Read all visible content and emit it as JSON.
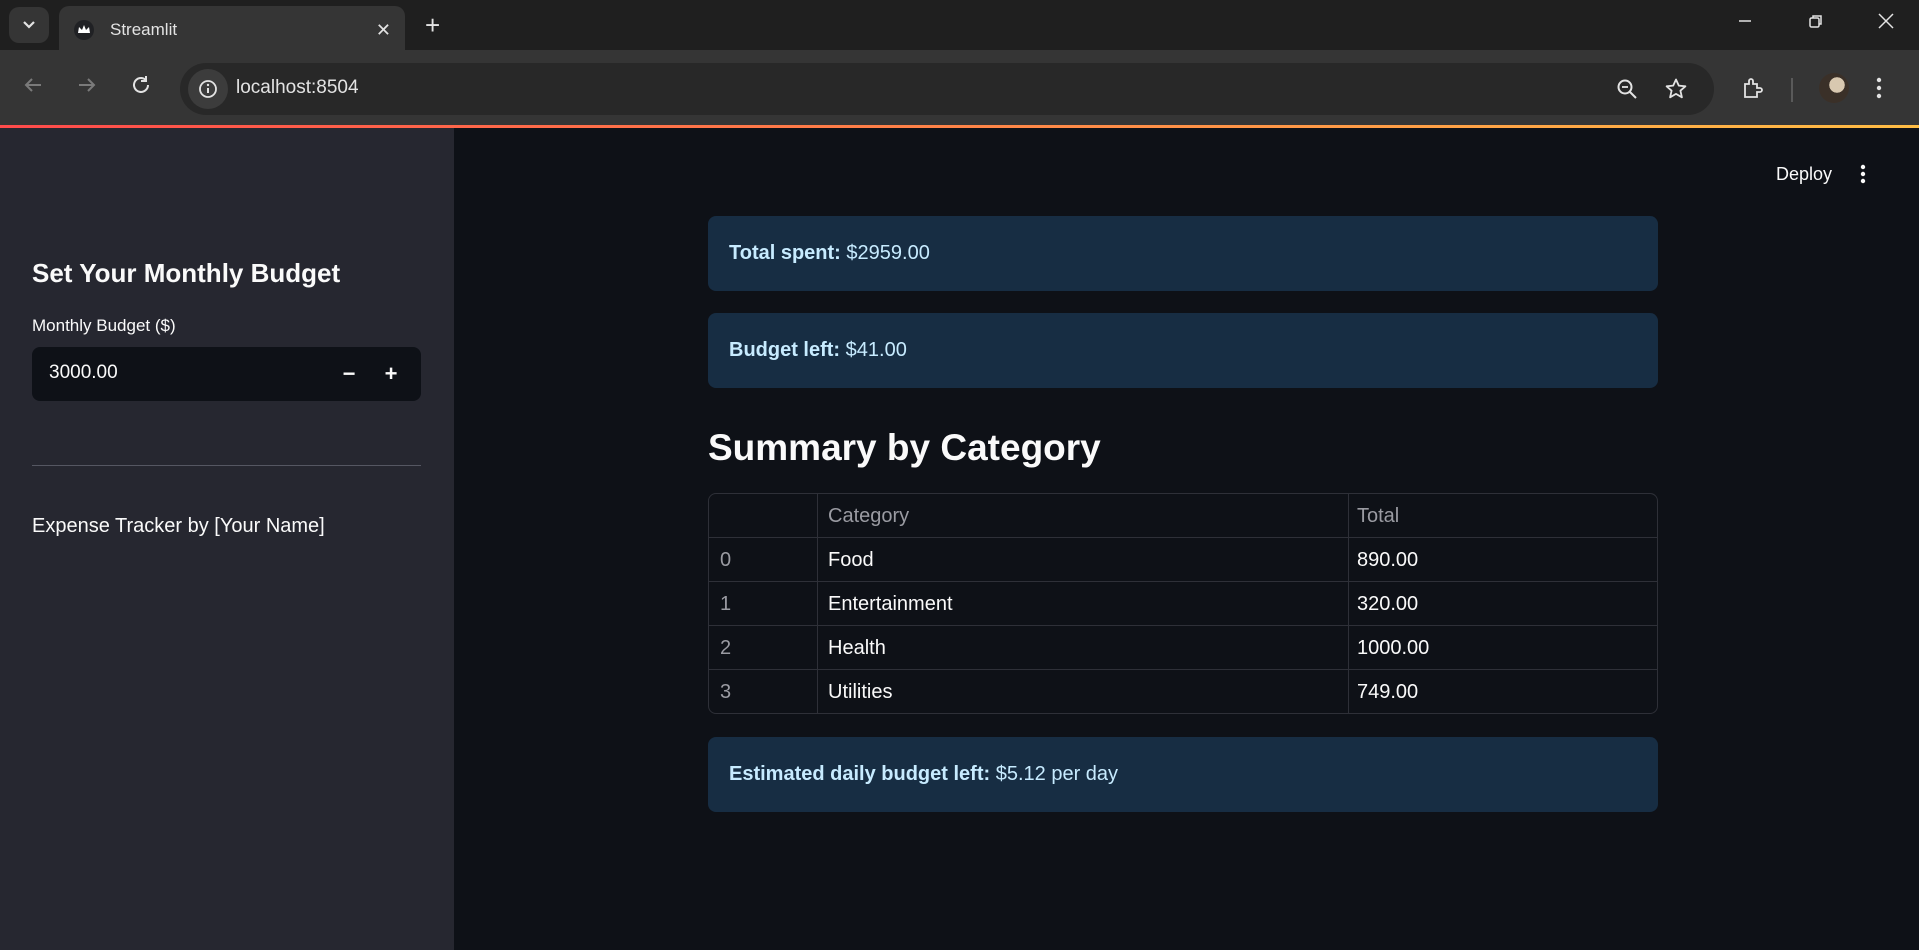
{
  "browser": {
    "tab_title": "Streamlit",
    "url": "localhost:8504"
  },
  "header": {
    "deploy_label": "Deploy"
  },
  "sidebar": {
    "title": "Set Your Monthly Budget",
    "budget_label": "Monthly Budget ($)",
    "budget_value": "3000.00",
    "decrement_label": "−",
    "increment_label": "+",
    "footer_text": "Expense Tracker by [Your Name]"
  },
  "main": {
    "total_spent": {
      "label": "Total spent:",
      "value": "$2959.00"
    },
    "budget_left": {
      "label": "Budget left:",
      "value": "$41.00"
    },
    "summary_title": "Summary by Category",
    "table": {
      "columns": [
        "",
        "Category",
        "Total"
      ],
      "rows": [
        {
          "index": "0",
          "category": "Food",
          "total": "890.00"
        },
        {
          "index": "1",
          "category": "Entertainment",
          "total": "320.00"
        },
        {
          "index": "2",
          "category": "Health",
          "total": "1000.00"
        },
        {
          "index": "3",
          "category": "Utilities",
          "total": "749.00"
        }
      ]
    },
    "daily_budget": {
      "label": "Estimated daily budget left:",
      "value": "$5.12 per day"
    }
  },
  "colors": {
    "app_background": "#0e1117",
    "sidebar_background": "#262730",
    "info_background": "#172d43",
    "info_text": "#c7ebff",
    "accent_gradient_start": "#ff4b4b",
    "accent_gradient_end": "#ffbd45"
  }
}
